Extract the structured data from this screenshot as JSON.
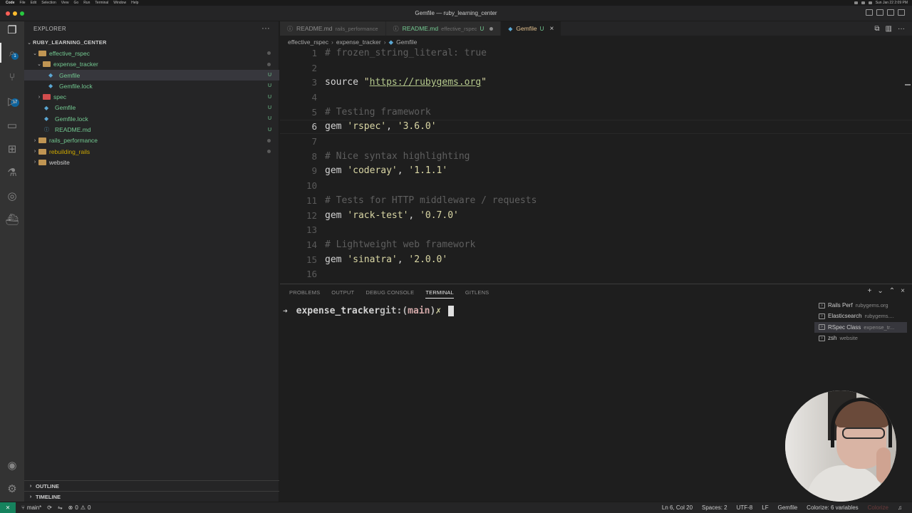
{
  "menubar": {
    "items": [
      "Code",
      "File",
      "Edit",
      "Selection",
      "View",
      "Go",
      "Run",
      "Terminal",
      "Window",
      "Help"
    ],
    "clock": "Sun Jan 22  2:09 PM"
  },
  "window": {
    "title": "Gemfile — ruby_learning_center"
  },
  "activity_bar": {
    "scm_badge": "17",
    "explorer_badge": "1"
  },
  "sidebar": {
    "header": "EXPLORER",
    "more": "···",
    "root": "RUBY_LEARNING_CENTER",
    "tree": [
      {
        "label": "effective_rspec",
        "status": ""
      },
      {
        "label": "expense_tracker",
        "status": ""
      },
      {
        "label": "Gemfile",
        "status": "U"
      },
      {
        "label": "Gemfile.lock",
        "status": "U"
      },
      {
        "label": "spec",
        "status": "U"
      },
      {
        "label": "Gemfile",
        "status": "U"
      },
      {
        "label": "Gemfile.lock",
        "status": "U"
      },
      {
        "label": "README.md",
        "status": "U"
      },
      {
        "label": "rails_performance",
        "status": ""
      },
      {
        "label": "rebuilding_rails",
        "status": ""
      },
      {
        "label": "website",
        "status": ""
      }
    ],
    "outline": "OUTLINE",
    "timeline": "TIMELINE"
  },
  "tabs": [
    {
      "label": "README.md",
      "desc": "rails_performance"
    },
    {
      "label": "README.md",
      "desc": "effective_rspec",
      "status": "U"
    },
    {
      "label": "Gemfile",
      "status": "U"
    }
  ],
  "breadcrumb": [
    "effective_rspec",
    "expense_tracker",
    "Gemfile"
  ],
  "editor": {
    "lines": [
      {
        "n": "1",
        "comment": "# frozen_string_literal: true"
      },
      {
        "n": "2"
      },
      {
        "n": "3",
        "kw": "source ",
        "q1": "\"",
        "url": "https://rubygems.org",
        "q2": "\""
      },
      {
        "n": "4"
      },
      {
        "n": "5",
        "comment": "# Testing framework"
      },
      {
        "n": "6",
        "kw": "gem ",
        "s1": "'rspec'",
        "sep": ", ",
        "s2": "'3.6.0'"
      },
      {
        "n": "7"
      },
      {
        "n": "8",
        "comment": "# Nice syntax highlighting"
      },
      {
        "n": "9",
        "kw": "gem ",
        "s1": "'coderay'",
        "sep": ", ",
        "s2": "'1.1.1'"
      },
      {
        "n": "10"
      },
      {
        "n": "11",
        "comment": "# Tests for HTTP middleware / requests"
      },
      {
        "n": "12",
        "kw": "gem ",
        "s1": "'rack-test'",
        "sep": ", ",
        "s2": "'0.7.0'"
      },
      {
        "n": "13"
      },
      {
        "n": "14",
        "comment": "# Lightweight web framework"
      },
      {
        "n": "15",
        "kw": "gem ",
        "s1": "'sinatra'",
        "sep": ", ",
        "s2": "'2.0.0'"
      },
      {
        "n": "16"
      }
    ]
  },
  "panel": {
    "tabs": [
      "PROBLEMS",
      "OUTPUT",
      "DEBUG CONSOLE",
      "TERMINAL",
      "GITLENS"
    ],
    "prompt": {
      "arrow": "➜",
      "dir": "expense_tracker",
      "git": "git:(",
      "branch": "main",
      "git_close": ")",
      "dirty": "✗"
    },
    "terminals": [
      {
        "name": "Rails Perf",
        "desc": "rubygems.org"
      },
      {
        "name": "Elasticsearch",
        "desc": "rubygems...."
      },
      {
        "name": "RSpec Class",
        "desc": "expense_tr..."
      },
      {
        "name": "zsh",
        "desc": "website"
      }
    ]
  },
  "statusbar": {
    "branch": "main*",
    "errors": "0",
    "warnings": "0",
    "position": "Ln 6, Col 20",
    "spaces": "Spaces: 2",
    "encoding": "UTF-8",
    "eol": "LF",
    "language": "Gemfile",
    "colorize": "Colorize: 6 variables",
    "colorize_off": "Colorize"
  },
  "colors": {
    "accent": "#0e639c",
    "untracked": "#73c991",
    "modified_tab": "#e2c08d"
  }
}
